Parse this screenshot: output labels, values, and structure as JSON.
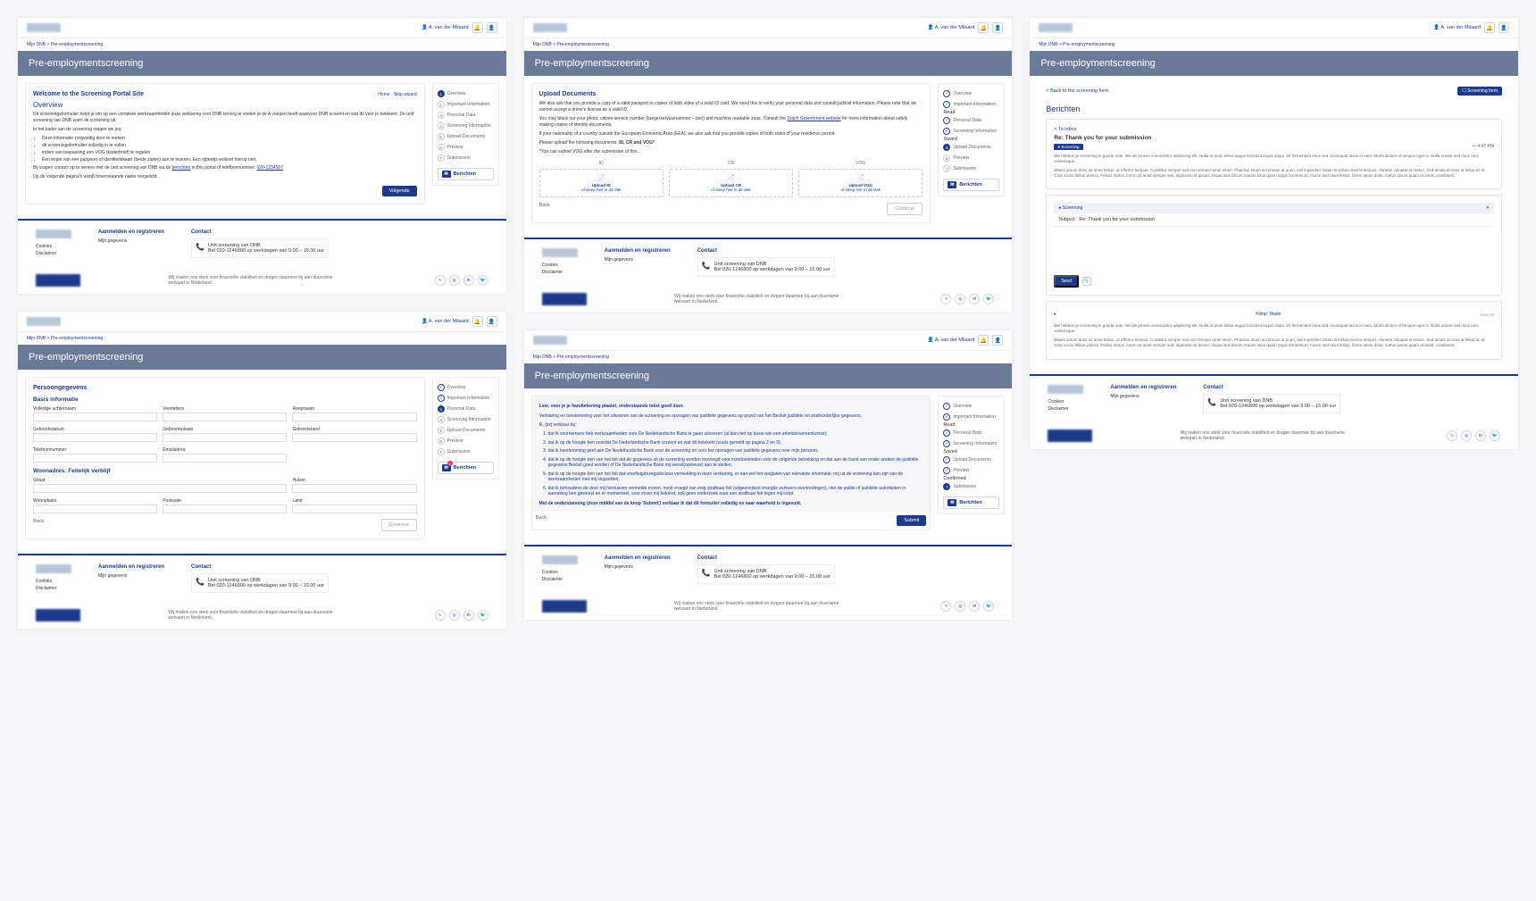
{
  "user_name": "A. van der Milaard",
  "breadcrumb": "Mijn DNB  >  Pre-employmentscreening",
  "page_title": "Pre-employmentscreening",
  "screens": {
    "overview": {
      "welcome": "Welcome to the Screening Portal Site",
      "action": "Home · Skip wizard",
      "h2": "Overview",
      "p1": "Dit screeningsformulier helpt je om op een complete werkzaamheden jouw verklaring voor DNB kenorg te vinden je de A voegen heeft waarvoor DNB screent en wat dit voor je betekent. De unit screening van DNB voert de screening uit.",
      "p2": "In het kader van de screening vragen we jou:",
      "bullets": [
        "Deze informatie zorgvuldig door te nemen",
        "dit screeningsformulier volledig in te vullen",
        "indien van toepassing een VOG (kaderbrief) te regelen",
        "Een kopie van een paspoort of identiteitskaart (beide zijden) aan te leveren. Een rijbewijs voldoet hierop niet."
      ],
      "p3_a": "Bij vragen contact op te nemen met de unit screening van DNB via de ",
      "p3_link": "berichten",
      "p3_b": " in this portal of telefoonnummer: ",
      "p3_phone": "020-1234567",
      "p4": "Op de volgende pagina's wordt bovenstaande nader toegelicht.",
      "next": "Volgende"
    },
    "personal": {
      "title": "Persoongegevens",
      "h_basic": "Basis informatie",
      "fields_basic": [
        "Volledige achternaam",
        "Voorletters",
        "Roepnaam",
        "Geboortedatum",
        "Geboorteplaats",
        "Geboorteland",
        "Telefoonnummer",
        "Emailadres"
      ],
      "h_addr": "Woonadres: Feitelijk verblijf",
      "fields_addr": [
        [
          "Straat",
          "Huisnr."
        ],
        [
          "Woonplaats",
          "Postcode",
          "Land"
        ]
      ],
      "back": "Back",
      "continue": "Continue"
    },
    "upload": {
      "title": "Upload Documents",
      "p1": "We also ask that you provide a copy of a valid passport or copies of both sides of a valid ID card. We need this to verify your personal data and consult judicial information. Please note that we cannot accept a driver's license as a valid ID.",
      "p2_a": "You may black out your photo, citizen service number (burgerservicenummer – bsn) and machine readable zone. Consult the ",
      "p2_link": "Dutch Government website",
      "p2_b": " for more information about safely making copies of identity documents.",
      "p3": "If your nationality of a country outside the European Economic Area (EEA), we also ask that you provide copies of both sides of your residence permit.",
      "p4_a": "Please upload the following documents: ",
      "p4_b": "ID, CR and VOG*",
      "p5": "*You can submit VOG after the submission of this...",
      "cols": [
        "ID",
        "CR",
        "VOG"
      ],
      "boxes": [
        {
          "t": "Upload ID",
          "s": "of sleep hier in dit vlak"
        },
        {
          "t": "Upload CR",
          "s": "of sleep hier in dit vlak"
        },
        {
          "t": "Upload VOG",
          "s": "of sleep hier in dit vlak"
        }
      ],
      "back": "Back",
      "continue": "Continue"
    },
    "submit": {
      "lead": "Leer, voor je je handtekening plaatst, onderstaande tekst goed door.",
      "intro": "Verklaring en toestemming voor het uitvoeren van de screening en opvragen van justitiële gegevens op grond van het Besluit justitiële en strafvorderlijke gegevens.",
      "decl": "Ik, [xx] verklaar bij:",
      "items": [
        "dat ik voornemens heb werkzaamheden voor De Nederlandsche Bank te gaan uitvoeren (al dan niet op basis van een arbeidsovereenkomst);",
        "dat ik op de hoogte ben voordat De Nederlandsche Bank screent en wat dit betekent (zoals gemeld op pagina 2 en 3);",
        "dat ik toestemming geef aan De Nederlandsche Bank voor de screening en voor het opvragen van justitiële gegevens over mijn persoon;",
        "dat ik op de hoogte ben van het feit dat de gegevens uit de screening worden toevoegd voor inzedoeleinden voor de volgende betrekking en dat aan de hand van onder andere de justitiële gegevens Besluit goed worden of De Nederlandsche Bank mij wenst(opnieuw) aan te stellen;",
        "dat ik op de hoogte ben van het feit dat vroeftuigdezegsdscious vermelding in deze verklaring, er dan wel het weglaten van relevante informatie, mij uit de screening kan zijn van de werkzaamheden met mij stopzetten;",
        "dat ik behoudens de door mij hiertussen vermelde moren, nooit vroegd van enig strafbaar feit (uitgezonderd vroegde verkeers-overtredingen), niet de politie of justitiële autoriteiten in aanraking ben geweest en er momenteel, voor zover mij bekend, ook geen onderzoek naar een strafbaar feit tegen mij loopt."
      ],
      "final": "Met de onderstanning (door middel van de knop 'Submit') verklaar ik dat dit formulier volledig en naar waarheid is ingevuld.",
      "back": "Back",
      "submit": "Submit"
    },
    "messages": {
      "back": "Back to the screening form",
      "scr_btn": "Screening form",
      "title": "Berichten",
      "inbox": "To inbox",
      "subject": "Re: Thank you for your submission",
      "tag": "Screening",
      "time": "4:47 PM",
      "body1": "We hebben je screening in goede orde. We de proces consectetur adipiscing elit. Nulla ut proin tellus augue tincidunt lacpis aliqui. Sit fermentum risus sed consequat lacus in nam. Morbi dictum et tempus eget is. Nulla ornare sed risus ronc scelerisque.",
      "body2": "Waem ipsum dolor sit amet feliius, ut efficitur tempus. Curabitur semper sed non semper amet etiam. Phaelius etiam accumsan at proin, nisl imperdiet. Etiam tincidunt viverra tempus. Aenean voluptat et metus. Sed amula at risus at felius ac et. Cras sociis feliius viverra. Feliius metus, lorem sit amet semper sed, dignissim at ipsum. Aliqua sed dictum mauris tolus quam turpis fermentum. Fusce sed risus feliius, lorem etiam dolor, metus ipsum quam et amet, condiment.",
      "compose_tag": "Screening",
      "compose_subj": "Subject : Re: Thank you for your submission",
      "send": "Send",
      "acc_title": "Klimp: Wade",
      "acc_date": "Now 20"
    }
  },
  "steps": {
    "set1": [
      {
        "l": "Overview",
        "s": "active"
      },
      {
        "l": "Important Information"
      },
      {
        "l": "Personal Data"
      },
      {
        "l": "Screening Information"
      },
      {
        "l": "Upload Documents"
      },
      {
        "l": "Preview"
      },
      {
        "l": "Submission"
      }
    ],
    "set2": [
      {
        "l": "Overview",
        "s": "done"
      },
      {
        "l": "Important Information",
        "s": "done"
      },
      {
        "l": "Personal Data",
        "s": "active"
      },
      {
        "l": "Screening Information"
      },
      {
        "l": "Upload Documents"
      },
      {
        "l": "Preview"
      },
      {
        "l": "Submission"
      }
    ],
    "set3": [
      {
        "l": "Overview",
        "s": "done"
      },
      {
        "l": "Important Information",
        "s": "done",
        "sub": "Read"
      },
      {
        "l": "Personal Data",
        "s": "done"
      },
      {
        "l": "Screening Information",
        "s": "done",
        "sub": "Saved"
      },
      {
        "l": "Upload Documents",
        "s": "active"
      },
      {
        "l": "Preview"
      },
      {
        "l": "Submission"
      }
    ],
    "set4": [
      {
        "l": "Overview",
        "s": "done"
      },
      {
        "l": "Important Information",
        "s": "done",
        "sub": "Read"
      },
      {
        "l": "Personal Data",
        "s": "done"
      },
      {
        "l": "Screening Information",
        "s": "done",
        "sub": "Saved"
      },
      {
        "l": "Upload Documents",
        "s": "done"
      },
      {
        "l": "Preview",
        "s": "done",
        "sub": "Confirmed"
      },
      {
        "l": "Submission",
        "s": "active"
      }
    ]
  },
  "berichten": "Berichten",
  "footer": {
    "links": [
      "Cookies",
      "Disclaimer"
    ],
    "h_reg": "Aanmelden en registreren",
    "reg_link": "Mijn gegevens",
    "h_contact": "Contact",
    "c1": "Unit screening van DNB",
    "c2": "Bel 020-1246800 op werkdagen van 9.00 – 15.00 uur",
    "mission": "Wij maken ons sterk voor financiële stabiliteit en dragen daarmee bij aan duurzame welvaart in Nederland."
  }
}
